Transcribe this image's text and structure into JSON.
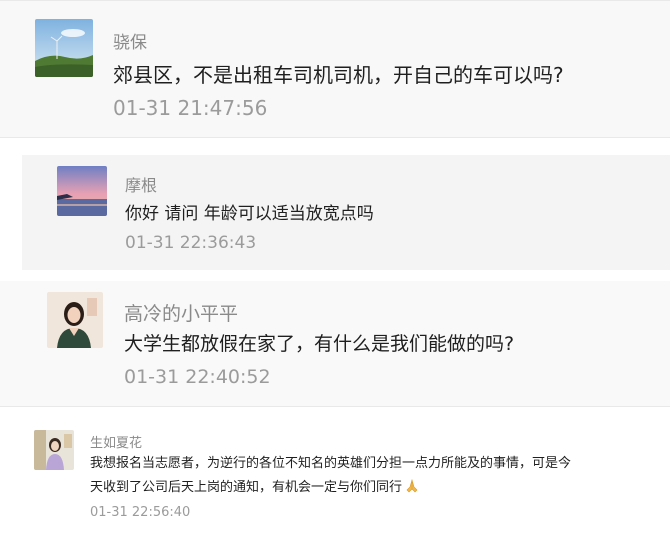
{
  "comments": [
    {
      "user": "骁保",
      "avatar_icon": "landscape-windmill",
      "text": "郊县区，不是出租车司机司机，开自己的车可以吗?",
      "time": "01-31 21:47:56"
    },
    {
      "user": "摩根",
      "avatar_icon": "sunset-sea",
      "text": "你好 请问 年龄可以适当放宽点吗",
      "time": "01-31 22:36:43"
    },
    {
      "user": "高冷的小平平",
      "avatar_icon": "woman-portrait",
      "text": "大学生都放假在家了，有什么是我们能做的吗?",
      "time": "01-31 22:40:52"
    },
    {
      "user": "生如夏花",
      "avatar_icon": "child-portrait",
      "text_line1": "我想报名当志愿者，为逆行的各位不知名的英雄们分担一点力所能及的事情，可是今",
      "text_line2": "天收到了公司后天上岗的通知，有机会一定与你们同行",
      "emoji": "praying-hands",
      "time": "01-31 22:56:40"
    }
  ]
}
